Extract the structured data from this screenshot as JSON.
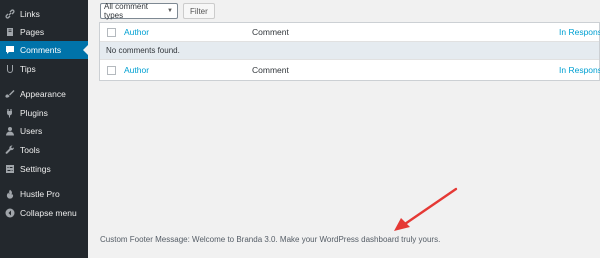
{
  "sidebar": {
    "items": [
      {
        "label": "Links",
        "icon": "link-icon"
      },
      {
        "label": "Pages",
        "icon": "pages-icon"
      },
      {
        "label": "Comments",
        "icon": "comments-icon",
        "active": true
      },
      {
        "label": "Tips",
        "icon": "tips-icon"
      },
      {
        "label": "Appearance",
        "icon": "paintbrush-icon"
      },
      {
        "label": "Plugins",
        "icon": "plugin-icon"
      },
      {
        "label": "Users",
        "icon": "user-icon"
      },
      {
        "label": "Tools",
        "icon": "wrench-icon"
      },
      {
        "label": "Settings",
        "icon": "settings-icon"
      },
      {
        "label": "Hustle Pro",
        "icon": "hustle-icon"
      },
      {
        "label": "Collapse menu",
        "icon": "collapse-icon"
      }
    ]
  },
  "filters": {
    "comment_type_selected": "All comment types",
    "filter_label": "Filter"
  },
  "table": {
    "columns": {
      "author": "Author",
      "comment": "Comment",
      "response": "In Response To"
    },
    "empty_message": "No comments found."
  },
  "footer": {
    "message": "Custom Footer Message: Welcome to Branda 3.0. Make your WordPress dashboard truly yours."
  },
  "colors": {
    "sidebar_bg": "#23282d",
    "active": "#0073aa",
    "link": "#00a0d2",
    "arrow": "#e53935"
  }
}
